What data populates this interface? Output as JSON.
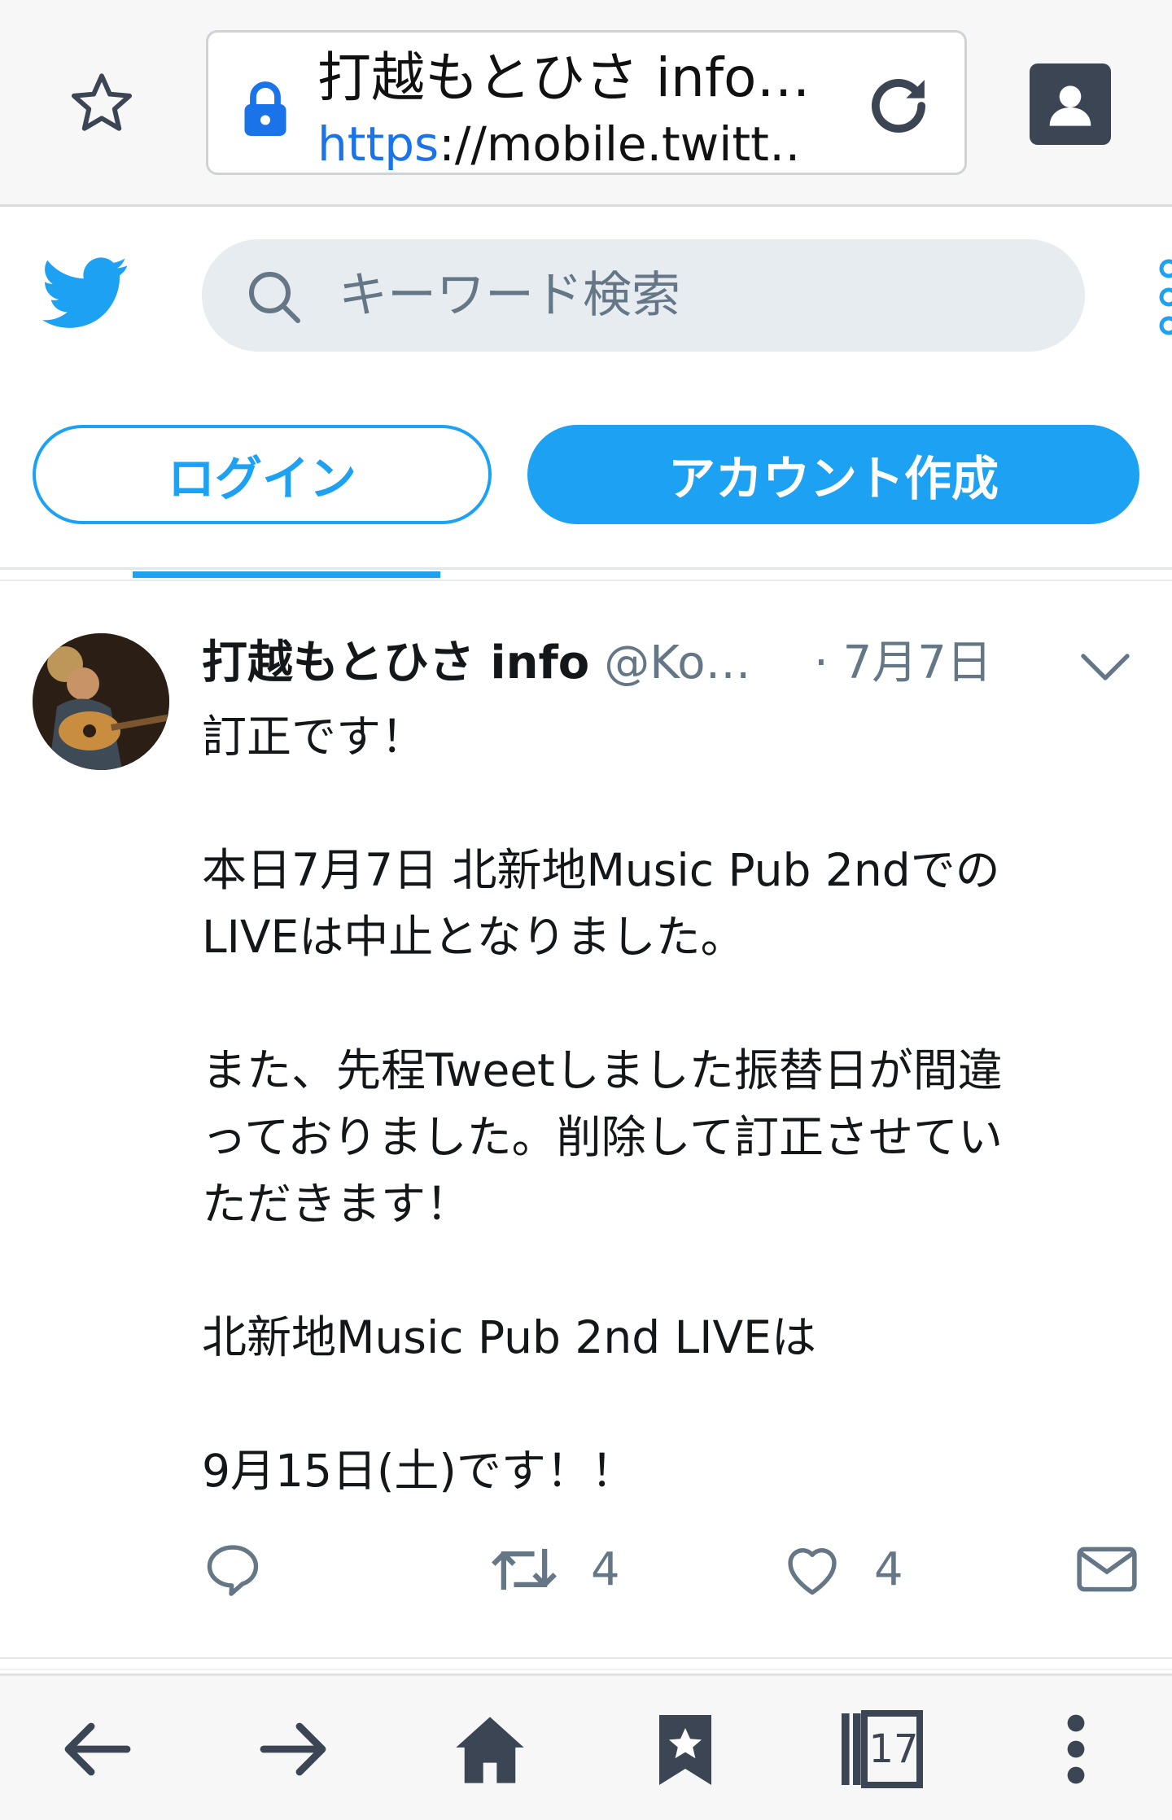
{
  "browser": {
    "tab_title": "打越もとひさ info…",
    "url_scheme": "https",
    "url_rest": "://mobile.twitt…"
  },
  "twitter": {
    "search_placeholder": "キーワード検索",
    "login_label": "ログイン",
    "signup_label": "アカウント作成"
  },
  "tweet": {
    "display_name": "打越もとひさ info",
    "handle": "@Ko…",
    "date": "· 7月7日",
    "paragraphs": [
      "訂正です！",
      "本日7月7日 北新地Music Pub 2ndでの\nLIVEは中止となりました。",
      "また、先程Tweetしました振替日が間違\nっておりました。削除して訂正させてい\nただきます！",
      "北新地Music Pub 2nd LIVEは",
      "9月15日(土)です！！"
    ],
    "retweet_count": "4",
    "like_count": "4"
  },
  "bottom_bar": {
    "tab_count": "17"
  },
  "colors": {
    "twitter_blue": "#1da1f2",
    "secondary_text": "#657786",
    "browser_icon": "#3b4554"
  }
}
